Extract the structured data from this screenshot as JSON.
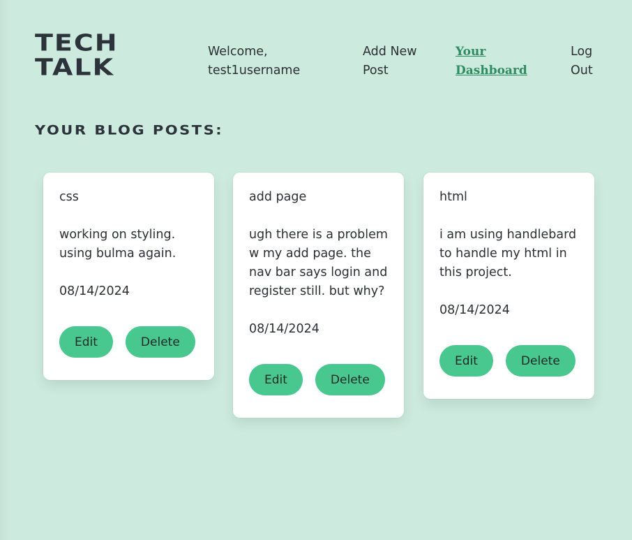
{
  "header": {
    "logo_line1": "TECH",
    "logo_line2": "TALK"
  },
  "nav": {
    "welcome_line1": "Welcome,",
    "welcome_line2": "test1username",
    "add_post_line1": "Add New",
    "add_post_line2": "Post",
    "dashboard_line1": "Your",
    "dashboard_line2": "Dashboard",
    "logout_line1": "Log",
    "logout_line2": "Out"
  },
  "main": {
    "section_title": "YOUR BLOG POSTS:",
    "posts": [
      {
        "title": "css",
        "body": "working on styling. using bulma again.",
        "date": "08/14/2024",
        "edit_label": "Edit",
        "delete_label": "Delete"
      },
      {
        "title": "add page",
        "body": "ugh there is a problem w my add page. the nav bar says login and register still. but why?",
        "date": "08/14/2024",
        "edit_label": "Edit",
        "delete_label": "Delete"
      },
      {
        "title": "html",
        "body": "i am using handlebard to handle my html in this project.",
        "date": "08/14/2024",
        "edit_label": "Edit",
        "delete_label": "Delete"
      }
    ]
  },
  "colors": {
    "background": "#cdeade",
    "accent": "#48c78e",
    "active_link": "#2e8c60",
    "card": "#ffffff"
  }
}
